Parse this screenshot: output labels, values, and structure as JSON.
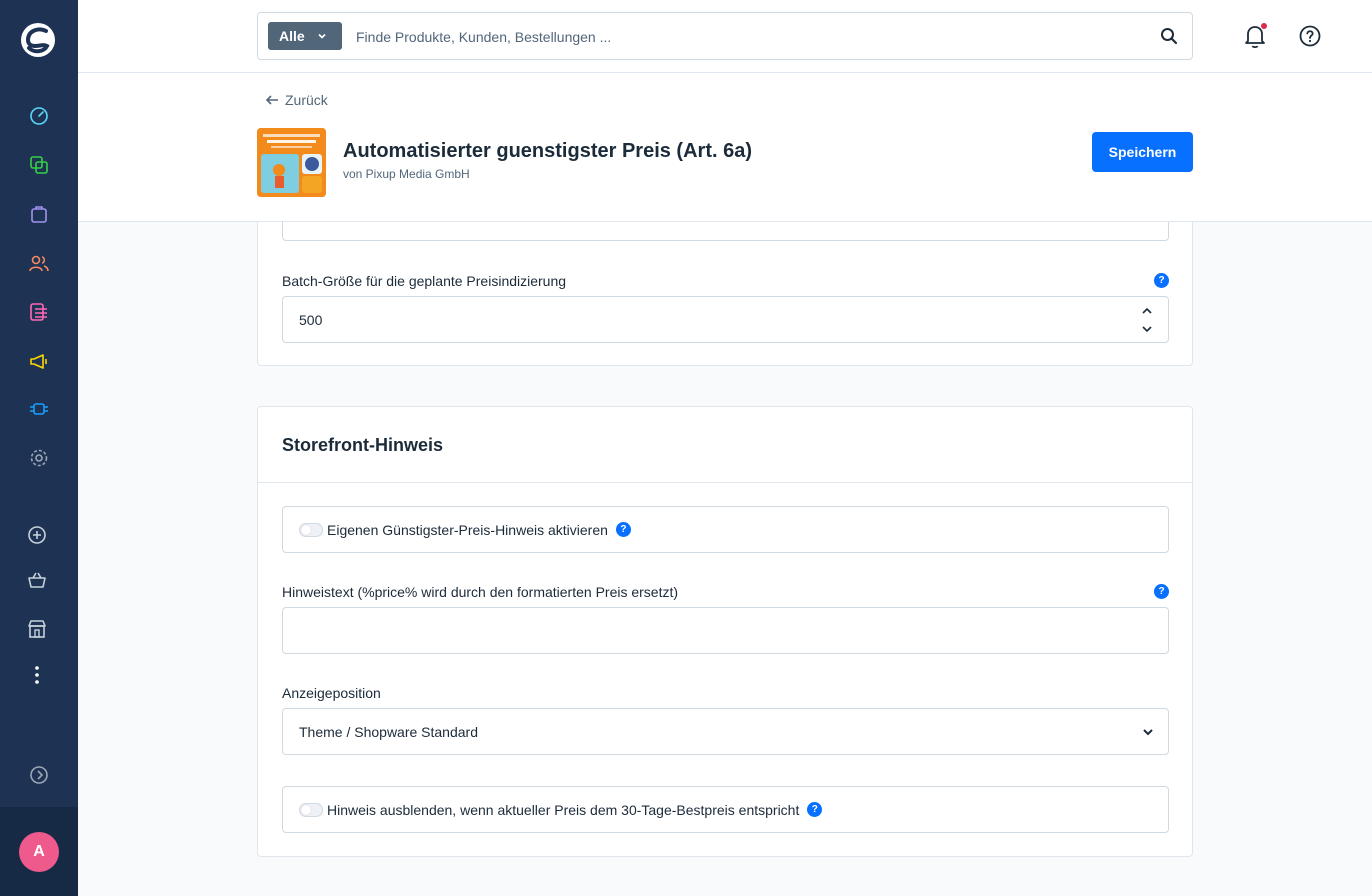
{
  "search": {
    "type_label": "Alle",
    "placeholder": "Finde Produkte, Kunden, Bestellungen ..."
  },
  "header": {
    "back_label": "Zurück",
    "title": "Automatisierter guenstigster Preis (Art. 6a)",
    "author": "von Pixup Media GmbH",
    "save_label": "Speichern"
  },
  "sidebar": {
    "avatar_initial": "A",
    "items": [
      "dashboard-icon",
      "catalogue-icon",
      "orders-icon",
      "customers-icon",
      "content-icon",
      "marketing-icon",
      "extensions-icon",
      "settings-icon",
      "add-circle-icon",
      "basket-icon",
      "storefront-icon",
      "more-icon",
      "expand-icon"
    ]
  },
  "batch_section": {
    "label": "Batch-Größe für die geplante Preisindizierung",
    "value": "500"
  },
  "storefront_section": {
    "title": "Storefront-Hinweis",
    "enable_label": "Eigenen Günstigster-Preis-Hinweis aktivieren",
    "hint_text_label": "Hinweistext (%price% wird durch den formatierten Preis ersetzt)",
    "hint_text_value": "",
    "position_label": "Anzeigeposition",
    "position_value": "Theme / Shopware Standard",
    "hide_label": "Hinweis ausblenden, wenn aktueller Preis dem 30-Tage-Bestpreis entspricht"
  },
  "colors": {
    "sidebar": "#1e3353",
    "primary": "#0870ff",
    "avatar": "#ee5a8c"
  }
}
